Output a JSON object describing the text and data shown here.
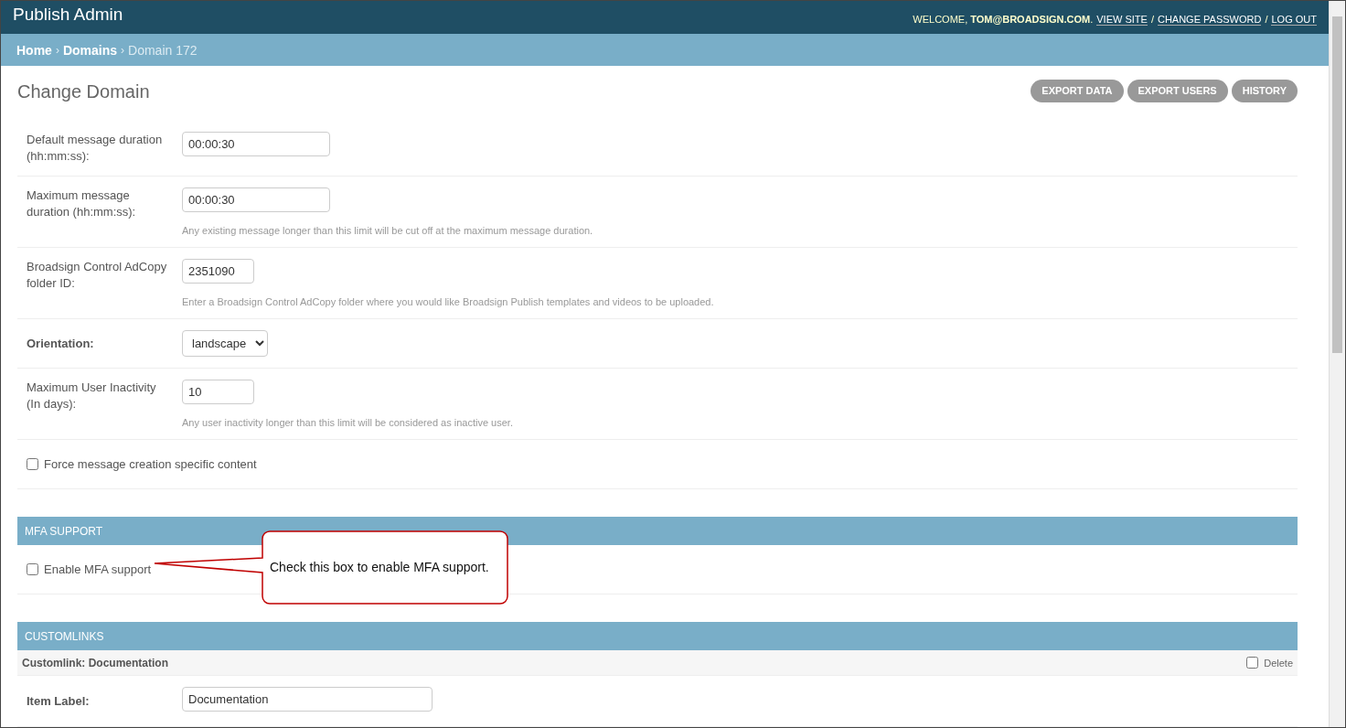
{
  "header": {
    "title": "Publish Admin",
    "welcome": "WELCOME,",
    "user": "TOM@BROADSIGN.COM",
    "tail": ".",
    "separator": "/",
    "links": [
      "VIEW SITE",
      "CHANGE PASSWORD",
      "LOG OUT"
    ]
  },
  "breadcrumb_separator": "›",
  "breadcrumbs": [
    {
      "label": "Home",
      "link": true
    },
    {
      "label": "Domains",
      "link": true
    },
    {
      "label": "Domain 172",
      "link": false
    }
  ],
  "page_title": "Change Domain",
  "actions": [
    "EXPORT DATA",
    "EXPORT USERS",
    "HISTORY"
  ],
  "fields": [
    {
      "kind": "text",
      "label": "Default message duration (hh:mm:ss):",
      "value": "00:00:30"
    },
    {
      "kind": "text",
      "label": "Maximum message duration (hh:mm:ss):",
      "value": "00:00:30",
      "help": "Any existing message longer than this limit will be cut off at the maximum message duration."
    },
    {
      "kind": "number",
      "label": "Broadsign Control AdCopy folder ID:",
      "value": "2351090",
      "help": "Enter a Broadsign Control AdCopy folder where you would like Broadsign Publish templates and videos to be uploaded."
    },
    {
      "kind": "select",
      "label": "Orientation:",
      "value": "landscape",
      "required": true
    },
    {
      "kind": "number",
      "label": "Maximum User Inactivity (In days):",
      "value": "10",
      "help": "Any user inactivity longer than this limit will be considered as inactive user."
    },
    {
      "kind": "checkbox",
      "label": "Force message creation specific content",
      "checked": false
    }
  ],
  "mfa": {
    "title": "MFA SUPPORT",
    "checkbox": {
      "label": "Enable MFA support",
      "checked": false
    },
    "callout": "Check this box to enable MFA support."
  },
  "customlinks": {
    "title": "CUSTOMLINKS",
    "item_title": "Customlink: Documentation",
    "delete": {
      "label": "Delete",
      "checked": false
    },
    "field": {
      "label": "Item Label:",
      "value": "Documentation"
    }
  }
}
